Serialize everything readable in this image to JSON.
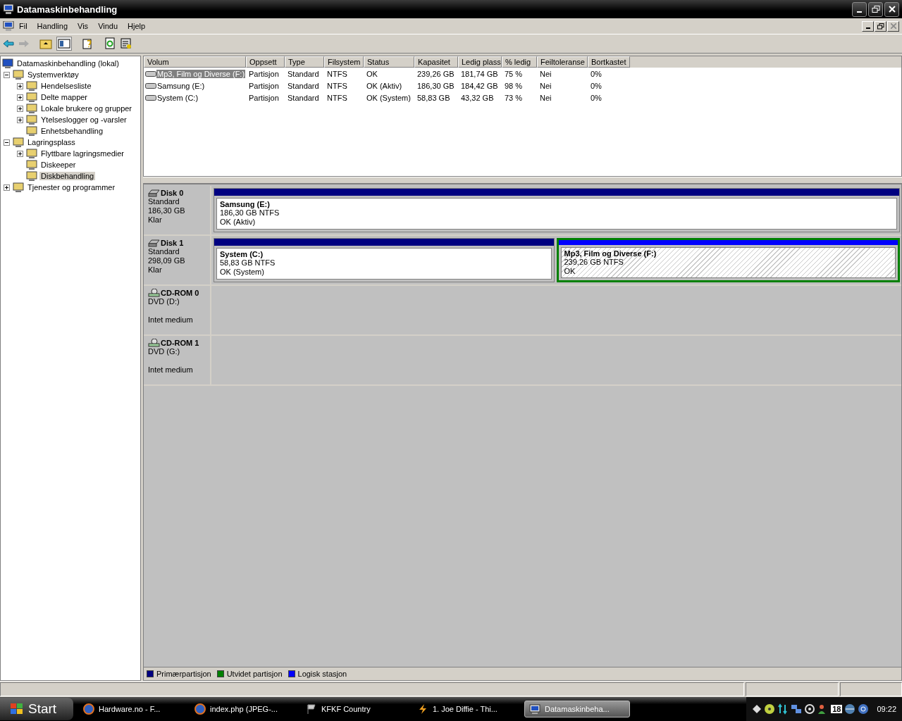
{
  "window": {
    "title": "Datamaskinbehandling"
  },
  "menu": [
    "Fil",
    "Handling",
    "Vis",
    "Vindu",
    "Hjelp"
  ],
  "tree": [
    {
      "label": "Datamaskinbehandling (lokal)",
      "selected": false,
      "children": [
        {
          "label": "Systemverktøy",
          "selected": false,
          "expanded": true,
          "children": [
            {
              "label": "Hendelsesliste",
              "selected": false,
              "expanded": false
            },
            {
              "label": "Delte mapper",
              "selected": false,
              "expanded": false
            },
            {
              "label": "Lokale brukere og grupper",
              "selected": false,
              "expanded": false
            },
            {
              "label": "Ytelseslogger og -varsler",
              "selected": false,
              "expanded": false
            },
            {
              "label": "Enhetsbehandling",
              "selected": false
            }
          ]
        },
        {
          "label": "Lagringsplass",
          "selected": false,
          "expanded": true,
          "children": [
            {
              "label": "Flyttbare lagringsmedier",
              "selected": false,
              "expanded": false
            },
            {
              "label": "Diskeeper",
              "selected": false
            },
            {
              "label": "Diskbehandling",
              "selected": true
            }
          ]
        },
        {
          "label": "Tjenester og programmer",
          "selected": false,
          "expanded": false
        }
      ]
    }
  ],
  "table": {
    "columns": [
      "Volum",
      "Oppsett",
      "Type",
      "Filsystem",
      "Status",
      "Kapasitet",
      "Ledig plass",
      "% ledig",
      "Feiltoleranse",
      "Bortkastet"
    ],
    "rows": [
      {
        "selected": true,
        "cells": [
          "Mp3, Film og Diverse (F:)",
          "Partisjon",
          "Standard",
          "NTFS",
          "OK",
          "239,26 GB",
          "181,74 GB",
          "75 %",
          "Nei",
          "0%"
        ]
      },
      {
        "selected": false,
        "cells": [
          "Samsung  (E:)",
          "Partisjon",
          "Standard",
          "NTFS",
          "OK (Aktiv)",
          "186,30 GB",
          "184,42 GB",
          "98 %",
          "Nei",
          "0%"
        ]
      },
      {
        "selected": false,
        "cells": [
          "System (C:)",
          "Partisjon",
          "Standard",
          "NTFS",
          "OK (System)",
          "58,83 GB",
          "43,32 GB",
          "73 %",
          "Nei",
          "0%"
        ]
      }
    ]
  },
  "disks": [
    {
      "kind": "disk",
      "name": "Disk 0",
      "lines": [
        "Standard",
        "186,30 GB",
        "Klar"
      ],
      "partitions": [
        {
          "kind": "primary",
          "selected": false,
          "name": "Samsung  (E:)",
          "size": "186,30 GB NTFS",
          "status": "OK (Aktiv)"
        }
      ]
    },
    {
      "kind": "disk",
      "name": "Disk 1",
      "lines": [
        "Standard",
        "298,09 GB",
        "Klar"
      ],
      "partitions": [
        {
          "kind": "primary",
          "selected": false,
          "name": "System  (C:)",
          "size": "58,83 GB NTFS",
          "status": "OK (System)"
        },
        {
          "kind": "logical",
          "selected": true,
          "name": "Mp3, Film og Diverse  (F:)",
          "size": "239,26 GB NTFS",
          "status": "OK"
        }
      ]
    },
    {
      "kind": "cdrom",
      "name": "CD-ROM 0",
      "lines": [
        "DVD (D:)"
      ],
      "status": "Intet medium"
    },
    {
      "kind": "cdrom",
      "name": "CD-ROM 1",
      "lines": [
        "DVD (G:)"
      ],
      "status": "Intet medium"
    }
  ],
  "legend": [
    {
      "label": "Primærpartisjon",
      "color": "#000080"
    },
    {
      "label": "Utvidet partisjon",
      "color": "#008000"
    },
    {
      "label": "Logisk stasjon",
      "color": "#0000ff"
    }
  ],
  "taskbar": {
    "start": "Start",
    "tasks": [
      {
        "label": "Hardware.no - F...",
        "kind": "browser",
        "selected": false
      },
      {
        "label": "index.php (JPEG-...",
        "kind": "browser",
        "selected": false
      },
      {
        "label": "KFKF Country",
        "kind": "flag",
        "selected": false
      },
      {
        "label": "1. Joe Diffie - Thi...",
        "kind": "player",
        "selected": false
      },
      {
        "label": "Datamaskinbeha...",
        "kind": "computer",
        "selected": true
      }
    ],
    "tray_badge": "18",
    "clock": "09:22"
  }
}
